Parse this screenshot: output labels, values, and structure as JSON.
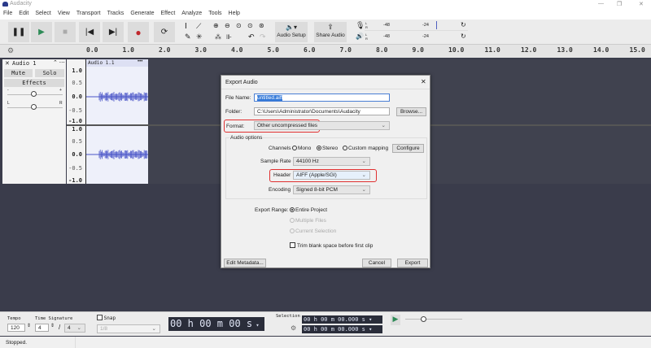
{
  "app": {
    "title": "Audacity",
    "window_controls": {
      "minimize": "—",
      "maximize": "❐",
      "close": "✕"
    }
  },
  "menu": [
    "File",
    "Edit",
    "Select",
    "View",
    "Transport",
    "Tracks",
    "Generate",
    "Effect",
    "Analyze",
    "Tools",
    "Help"
  ],
  "toolbar": {
    "audio_setup": "Audio Setup",
    "share_audio": "Share Audio",
    "meter_ticks": [
      "-48",
      "-24"
    ],
    "meter_lr": [
      "L",
      "R"
    ]
  },
  "ruler": {
    "ticks": [
      "0.0",
      "1.0",
      "2.0",
      "3.0",
      "4.0",
      "5.0",
      "6.0",
      "7.0",
      "8.0",
      "9.0",
      "10.0",
      "11.0",
      "12.0",
      "13.0",
      "14.0",
      "15.0"
    ]
  },
  "track": {
    "name": "Audio 1",
    "mute": "Mute",
    "solo": "Solo",
    "effects": "Effects",
    "gain_minus": "-",
    "gain_plus": "+",
    "pan_l": "L",
    "pan_r": "R",
    "clip_name": "Audio 1.1",
    "clip_menu": "•••",
    "scale": [
      "1.0",
      "0.5",
      "0.0",
      "-0.5",
      "-1.0"
    ]
  },
  "dialog": {
    "title": "Export Audio",
    "file_name_label": "File Name:",
    "file_name": "untitled.aiff",
    "folder_label": "Folder:",
    "folder": "C:\\Users\\Administrator\\Documents\\Audacity",
    "browse": "Browse...",
    "format_label": "Format:",
    "format": "Other uncompressed files",
    "audio_options": "Audio options",
    "channels_label": "Channels",
    "channels": [
      {
        "label": "Mono",
        "selected": false
      },
      {
        "label": "Stereo",
        "selected": true
      },
      {
        "label": "Custom mapping",
        "selected": false
      }
    ],
    "configure": "Configure",
    "sample_rate_label": "Sample Rate",
    "sample_rate": "44100 Hz",
    "header_label": "Header",
    "header": "AIFF (Apple/SGI)",
    "encoding_label": "Encoding",
    "encoding": "Signed 8-bit PCM",
    "export_range_label": "Export Range:",
    "ranges": [
      {
        "label": "Entire Project",
        "selected": true,
        "enabled": true
      },
      {
        "label": "Multiple Files",
        "selected": false,
        "enabled": false
      },
      {
        "label": "Current Selection",
        "selected": false,
        "enabled": false
      }
    ],
    "trim": "Trim blank space before first clip",
    "trim_checked": false,
    "edit_metadata": "Edit Metadata...",
    "cancel": "Cancel",
    "export": "Export"
  },
  "bottom": {
    "tempo_label": "Tempo",
    "tempo": "120",
    "time_sig_label": "Time Signature",
    "time_sig_num": "4",
    "time_sig_sep": "/",
    "time_sig_den": "4",
    "snap_label": "Snap",
    "snap_value": "1/8",
    "time": "00 h 00 m 00 s",
    "selection_label": "Selection",
    "sel_start": "00 h 00 m 00.000 s",
    "sel_end": "00 h 00 m 00.000 s"
  },
  "status": "Stopped.",
  "colors": {
    "accent_red": "#e03030",
    "waveform": "#4a55c8",
    "dark_bg": "#3a3c4b"
  }
}
